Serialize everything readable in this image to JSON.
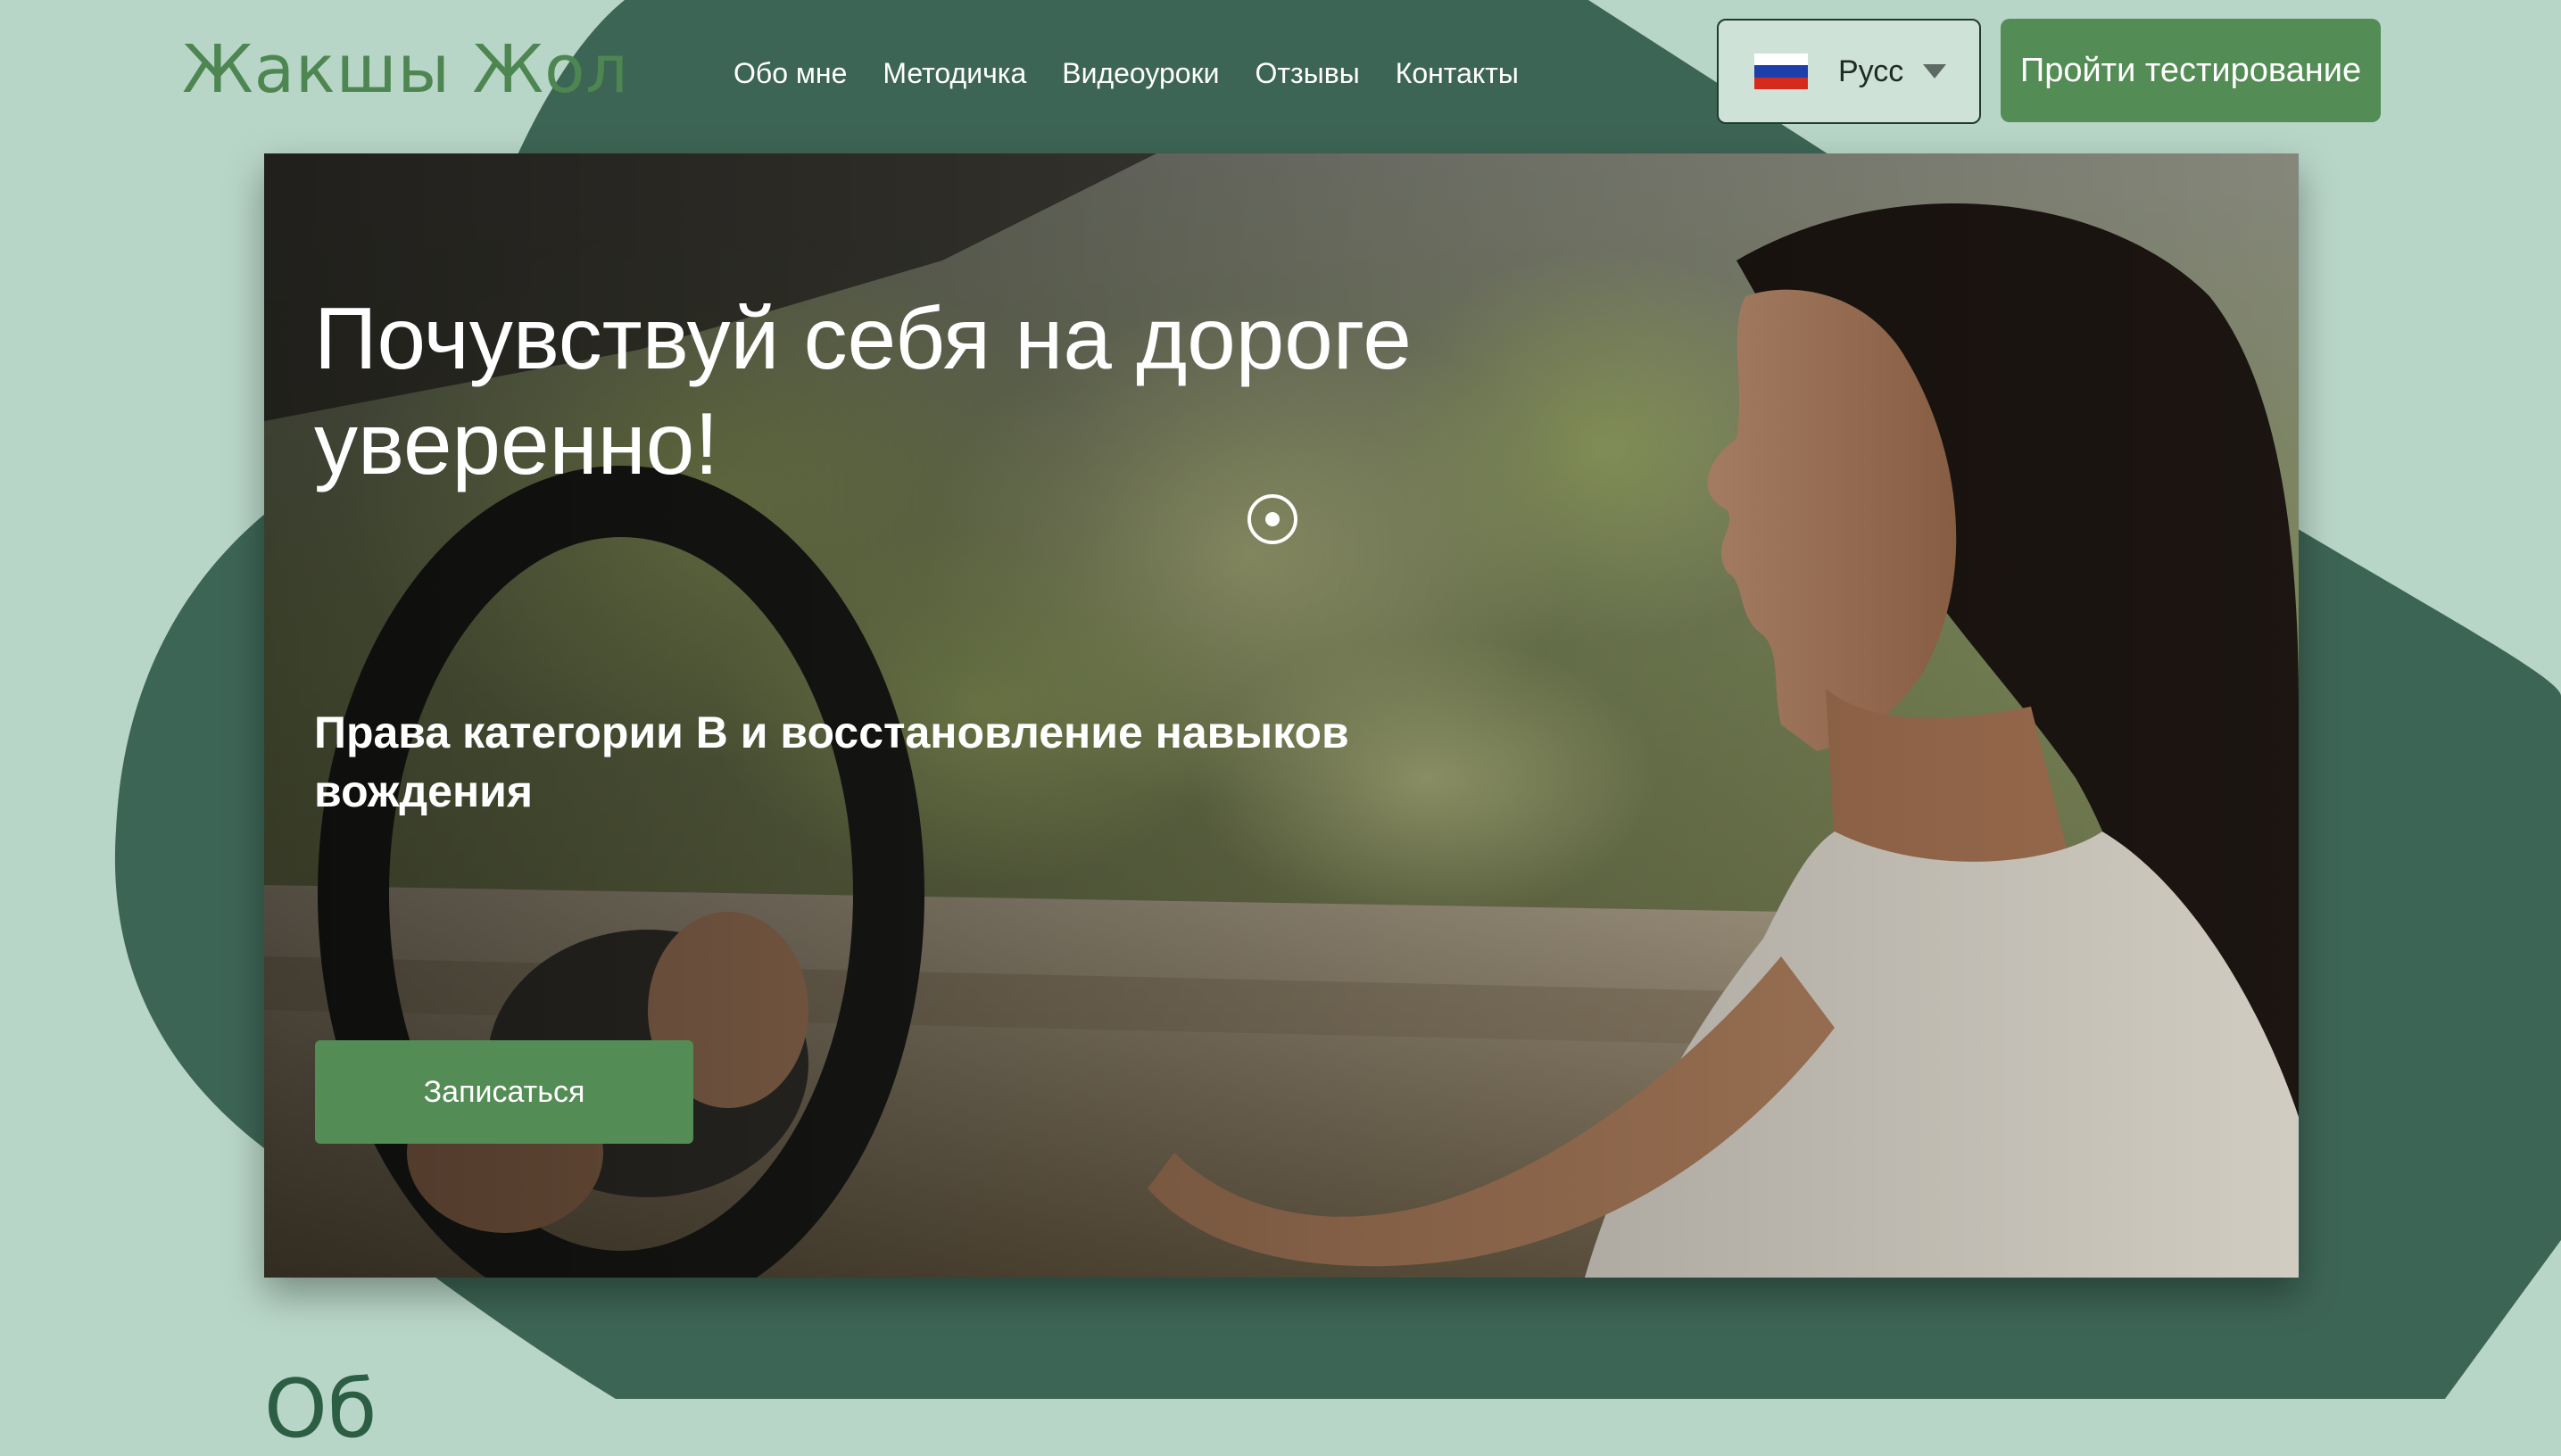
{
  "header": {
    "logo": "Жакшы Жол",
    "nav": [
      "Обо мне",
      "Методичка",
      "Видеоуроки",
      "Отзывы",
      "Контакты"
    ],
    "language": {
      "selected": "Русс",
      "flag_icon": "russia-flag-icon",
      "flag_colors": [
        "#ffffff",
        "#1c3faa",
        "#d52b1e"
      ]
    },
    "cta_label": "Пройти тестирование"
  },
  "hero": {
    "title": "Почувствуй себя на дороге уверенно!",
    "subtitle": "Права категории В и восстановление навыков вождения",
    "button_label": "Записаться",
    "image": "woman-driving-car-photo",
    "slider_icon": "slider-dot-icon"
  },
  "next_section": {
    "heading_partial": "Об"
  },
  "colors": {
    "page_bg": "#b8d6c8",
    "dark_green": "#3d6555",
    "accent_green": "#548c55",
    "logo_green": "#4e8652"
  }
}
